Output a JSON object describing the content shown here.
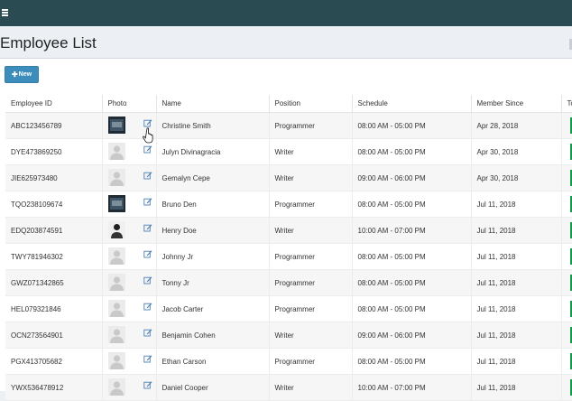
{
  "header": {
    "title": "Employee List"
  },
  "toolbar": {
    "new_label": "New"
  },
  "table": {
    "columns": [
      "Employee ID",
      "Photo",
      "Name",
      "Position",
      "Schedule",
      "Member Since",
      "To"
    ],
    "rows": [
      {
        "id": "ABC123456789",
        "name": "Christine Smith",
        "position": "Programmer",
        "schedule": "08:00 AM - 05:00 PM",
        "since": "Apr 28, 2018",
        "photo": "photo-dark"
      },
      {
        "id": "DYE473869250",
        "name": "Julyn Divinagracia",
        "position": "Writer",
        "schedule": "08:00 AM - 05:00 PM",
        "since": "Apr 30, 2018",
        "photo": "avatar-placeholder"
      },
      {
        "id": "JIE625973480",
        "name": "Gemalyn Cepe",
        "position": "Writer",
        "schedule": "09:00 AM - 06:00 PM",
        "since": "Apr 30, 2018",
        "photo": "avatar-placeholder"
      },
      {
        "id": "TQO238109674",
        "name": "Bruno Den",
        "position": "Programmer",
        "schedule": "08:00 AM - 05:00 PM",
        "since": "Jul 11, 2018",
        "photo": "photo-dark"
      },
      {
        "id": "EDQ203874591",
        "name": "Henry Doe",
        "position": "Writer",
        "schedule": "10:00 AM - 07:00 PM",
        "since": "Jul 11, 2018",
        "photo": "photo-person"
      },
      {
        "id": "TWY781946302",
        "name": "Johnny Jr",
        "position": "Programmer",
        "schedule": "08:00 AM - 05:00 PM",
        "since": "Jul 11, 2018",
        "photo": "avatar-placeholder"
      },
      {
        "id": "GWZ071342865",
        "name": "Tonny Jr",
        "position": "Programmer",
        "schedule": "08:00 AM - 05:00 PM",
        "since": "Jul 11, 2018",
        "photo": "avatar-placeholder"
      },
      {
        "id": "HEL079321846",
        "name": "Jacob Carter",
        "position": "Programmer",
        "schedule": "08:00 AM - 05:00 PM",
        "since": "Jul 11, 2018",
        "photo": "avatar-placeholder"
      },
      {
        "id": "OCN273564901",
        "name": "Benjamin Cohen",
        "position": "Writer",
        "schedule": "09:00 AM - 06:00 PM",
        "since": "Jul 11, 2018",
        "photo": "avatar-placeholder"
      },
      {
        "id": "PGX413705682",
        "name": "Ethan Carson",
        "position": "Programmer",
        "schedule": "08:00 AM - 05:00 PM",
        "since": "Jul 11, 2018",
        "photo": "avatar-placeholder"
      },
      {
        "id": "YWX536478912",
        "name": "Daniel Cooper",
        "position": "Writer",
        "schedule": "10:00 AM - 07:00 PM",
        "since": "Jul 11, 2018",
        "photo": "avatar-placeholder"
      }
    ]
  },
  "colors": {
    "topbar": "#2b4b52",
    "primary": "#3c8dbc",
    "status": "#159a4a"
  }
}
